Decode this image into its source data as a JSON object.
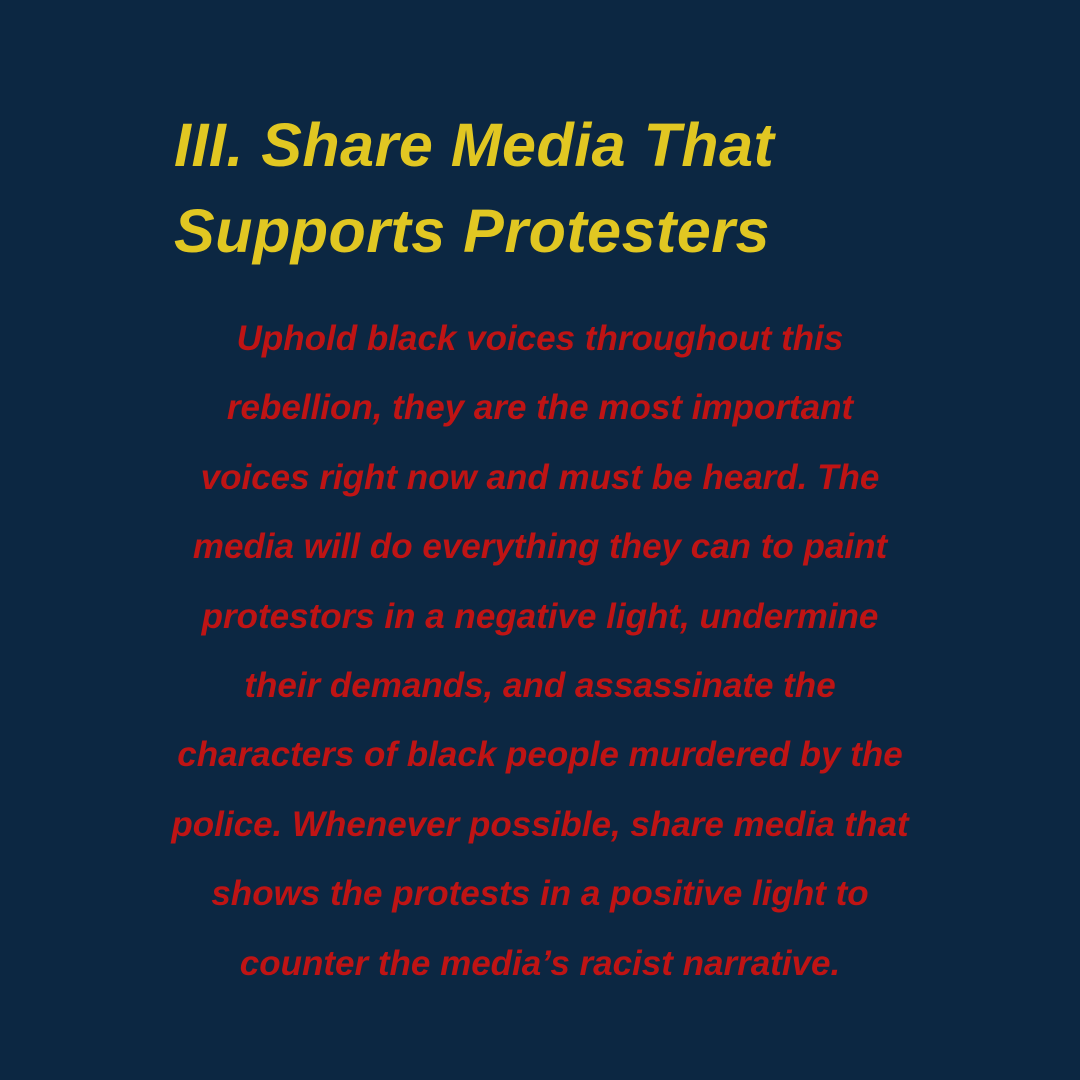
{
  "colors": {
    "background": "#0c2742",
    "title": "#e1c722",
    "body": "#bf1414"
  },
  "title": {
    "lines": [
      "III. Share Media That",
      "Supports Protesters"
    ]
  },
  "body": {
    "lines": [
      "Uphold black voices throughout this",
      "rebellion, they are the most important",
      "voices right now and must be heard. The",
      "media will do everything they can to paint",
      "protestors in a negative light, undermine",
      "their demands, and assassinate the",
      "characters of black people murdered by the",
      "police. Whenever possible, share media that",
      "shows the protests in a positive light to",
      "counter the media’s racist narrative."
    ]
  }
}
